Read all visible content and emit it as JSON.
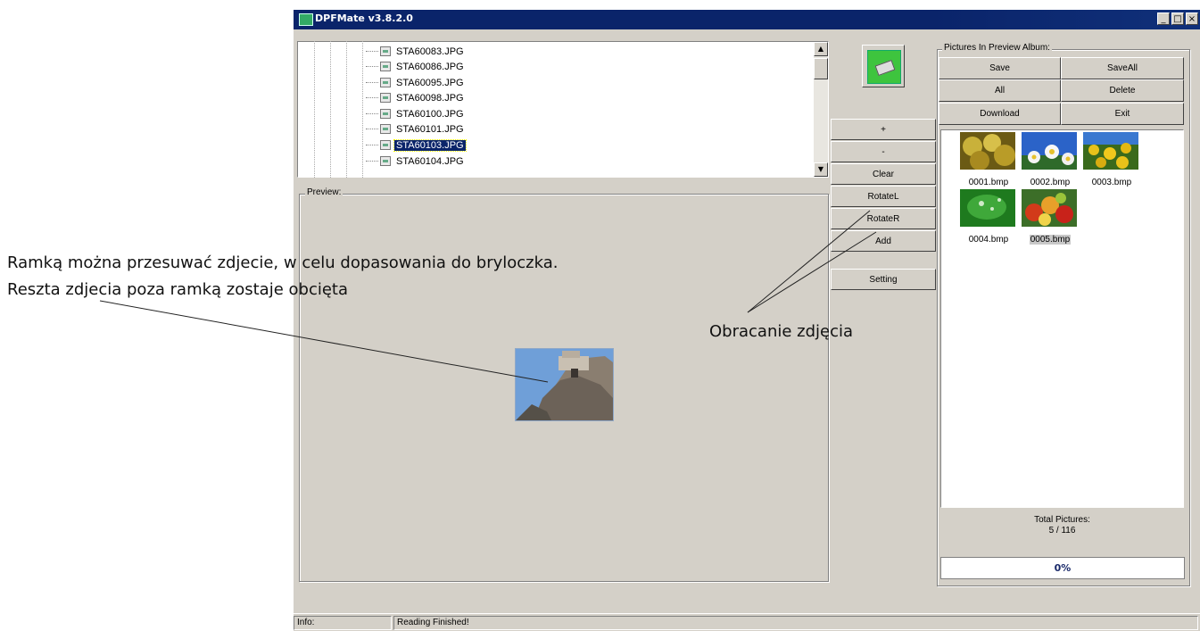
{
  "window": {
    "title": "DPFMate v3.8.2.0",
    "controls": {
      "minimize": "_",
      "maximize": "□",
      "close": "×"
    }
  },
  "file_tree": {
    "items": [
      {
        "label": "STA60083.JPG",
        "selected": false
      },
      {
        "label": "STA60086.JPG",
        "selected": false
      },
      {
        "label": "STA60095.JPG",
        "selected": false
      },
      {
        "label": "STA60098.JPG",
        "selected": false
      },
      {
        "label": "STA60100.JPG",
        "selected": false
      },
      {
        "label": "STA60101.JPG",
        "selected": false
      },
      {
        "label": "STA60103.JPG",
        "selected": true
      },
      {
        "label": "STA60104.JPG",
        "selected": false
      }
    ],
    "scroll_up": "▲",
    "scroll_down": "▼"
  },
  "preview": {
    "label": "Preview:"
  },
  "middle_buttons": {
    "plus": "+",
    "minus": "-",
    "clear": "Clear",
    "rotate_left": "RotateL",
    "rotate_right": "RotateR",
    "add": "Add",
    "setting": "Setting"
  },
  "album": {
    "label": "Pictures In Preview Album:",
    "buttons": {
      "save": "Save",
      "save_all": "SaveAll",
      "all": "All",
      "delete": "Delete",
      "download": "Download",
      "exit": "Exit"
    },
    "thumbnails": [
      {
        "caption": "0001.bmp",
        "selected": false
      },
      {
        "caption": "0002.bmp",
        "selected": false
      },
      {
        "caption": "0003.bmp",
        "selected": false
      },
      {
        "caption": "0004.bmp",
        "selected": false
      },
      {
        "caption": "0005.bmp",
        "selected": true
      }
    ],
    "total_label": "Total Pictures:",
    "total_value": "5 / 116",
    "progress_text": "0%",
    "progress_fraction": 0
  },
  "status_bar": {
    "info_label": "Info:",
    "message": "Reading Finished!"
  },
  "annotations": {
    "crop_line1": "Ramką można przesuwać zdjecie, w celu dopasowania do bryloczka.",
    "crop_line2": "Reszta zdjecia poza ramką zostaje obcięta",
    "rotate": "Obracanie zdjęcia"
  },
  "colors": {
    "titlebar": "#0a246a",
    "window_face": "#d4d0c8",
    "selection": "#0a246a",
    "progress_text": "#1a2a6a"
  }
}
